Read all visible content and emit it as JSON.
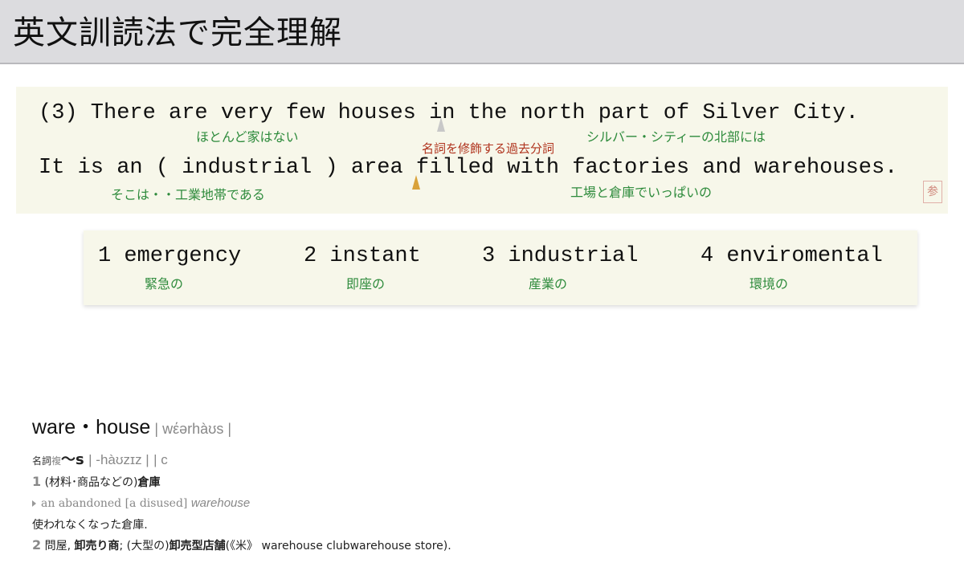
{
  "header": {
    "title": "英文訓読法で完全理解"
  },
  "sentence": {
    "line1": "(3) There are very few houses in the north part of Silver City.",
    "line2": "It is an ( industrial ) area filled with factories and warehouses.",
    "gloss_1a": "ほとんど家はない",
    "gloss_1b": "シルバー・シティーの北部には",
    "note": "名詞を修飾する過去分詞",
    "gloss_2a": "そこは・・工業地帯である",
    "gloss_2b": "工場と倉庫でいっぱいの"
  },
  "choices": [
    {
      "label": "1 emergency",
      "meaning": "緊急の"
    },
    {
      "label": "2 instant",
      "meaning": "即座の"
    },
    {
      "label": "3 industrial",
      "meaning": "産業の"
    },
    {
      "label": "4 enviromental",
      "meaning": "環境の"
    }
  ],
  "dictionary": {
    "headword": "ware・house",
    "pronunciation": "| wέərhàʊs |",
    "pos": "名詞",
    "plural_mark": "複",
    "plural_form": "〜s",
    "plural_pron": "| -hàʊzɪz |",
    "countable": "| c",
    "sense1_num": "1",
    "sense1_text": "(材料･商品などの)",
    "sense1_word": "倉庫",
    "example_text": "an abandoned [a disused]",
    "example_word": "warehouse",
    "example_translation": "使われなくなった倉庫.",
    "sense2_num": "2",
    "sense2_a": "問屋,",
    "sense2_b": "卸売り商",
    "sense2_c": "; (大型の)",
    "sense2_d": "卸売型店舗",
    "sense2_e": "(《米》 warehouse clubwarehouse store)."
  },
  "seal_char": "参"
}
